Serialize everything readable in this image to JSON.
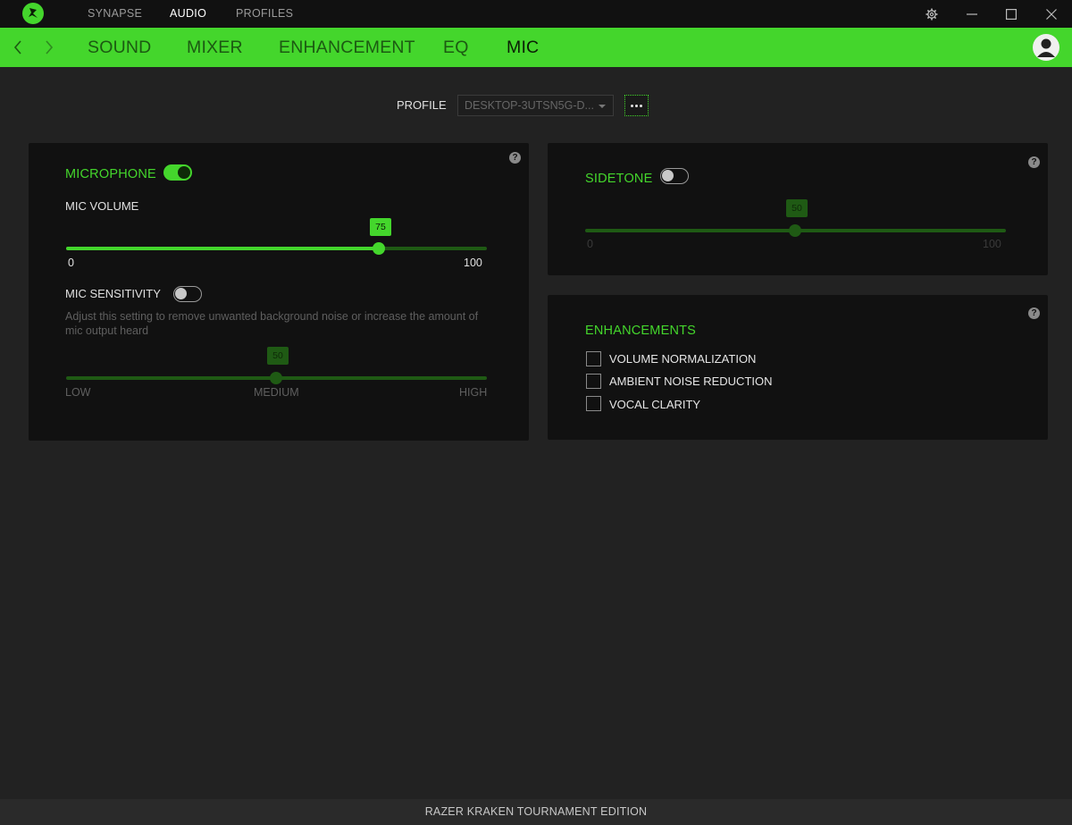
{
  "colors": {
    "accent": "#44d62c",
    "panel": "#111111",
    "background": "#222222"
  },
  "titlebar": {
    "logo_icon": "razer-logo-icon",
    "tabs": [
      {
        "label": "SYNAPSE",
        "active": false
      },
      {
        "label": "AUDIO",
        "active": true
      },
      {
        "label": "PROFILES",
        "active": false
      }
    ],
    "settings_icon": "gear-icon",
    "minimize_icon": "minimize-icon",
    "maximize_icon": "maximize-icon",
    "close_icon": "close-icon"
  },
  "subnav": {
    "back_icon": "chevron-left-icon",
    "forward_icon": "chevron-right-icon",
    "tabs": [
      {
        "label": "SOUND",
        "active": false
      },
      {
        "label": "MIXER",
        "active": false
      },
      {
        "label": "ENHANCEMENT",
        "active": false
      },
      {
        "label": "EQ",
        "active": false
      },
      {
        "label": "MIC",
        "active": true
      }
    ],
    "avatar_icon": "user-avatar-icon"
  },
  "profile": {
    "label": "PROFILE",
    "selected": "DESKTOP-3UTSN5G-D...",
    "more_icon": "more-dots-icon"
  },
  "microphone_panel": {
    "title": "MICROPHONE",
    "enabled": true,
    "mic_volume": {
      "label": "MIC VOLUME",
      "value": "75",
      "min": "0",
      "max": "100"
    },
    "mic_sensitivity": {
      "label": "MIC SENSITIVITY",
      "enabled": false,
      "description": "Adjust this setting to remove unwanted background noise or increase the amount of mic output heard",
      "value": "50",
      "low": "LOW",
      "medium": "MEDIUM",
      "high": "HIGH"
    },
    "help": "?"
  },
  "sidetone_panel": {
    "title": "SIDETONE",
    "enabled": false,
    "value": "50",
    "min": "0",
    "max": "100",
    "help": "?"
  },
  "enhancements_panel": {
    "title": "ENHANCEMENTS",
    "items": [
      {
        "label": "VOLUME NORMALIZATION",
        "checked": false
      },
      {
        "label": "AMBIENT NOISE REDUCTION",
        "checked": false
      },
      {
        "label": "VOCAL CLARITY",
        "checked": false
      }
    ],
    "help": "?"
  },
  "footer": {
    "device": "RAZER KRAKEN TOURNAMENT EDITION"
  }
}
